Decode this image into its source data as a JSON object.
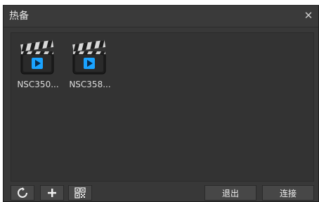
{
  "window": {
    "title": "热备",
    "close_icon": "close-icon"
  },
  "files": [
    {
      "name": "NSC350...",
      "icon": "video-clapper-icon"
    },
    {
      "name": "NSC358...",
      "icon": "video-clapper-icon"
    }
  ],
  "toolbar": {
    "refresh_icon": "refresh-icon",
    "add_icon": "plus-icon",
    "qr_icon": "qr-code-icon",
    "exit_label": "退出",
    "connect_label": "连接"
  },
  "colors": {
    "dialog_bg": "#383838",
    "content_bg": "#333333",
    "button_bg": "#474747",
    "play_blue": "#1aa3ff"
  }
}
